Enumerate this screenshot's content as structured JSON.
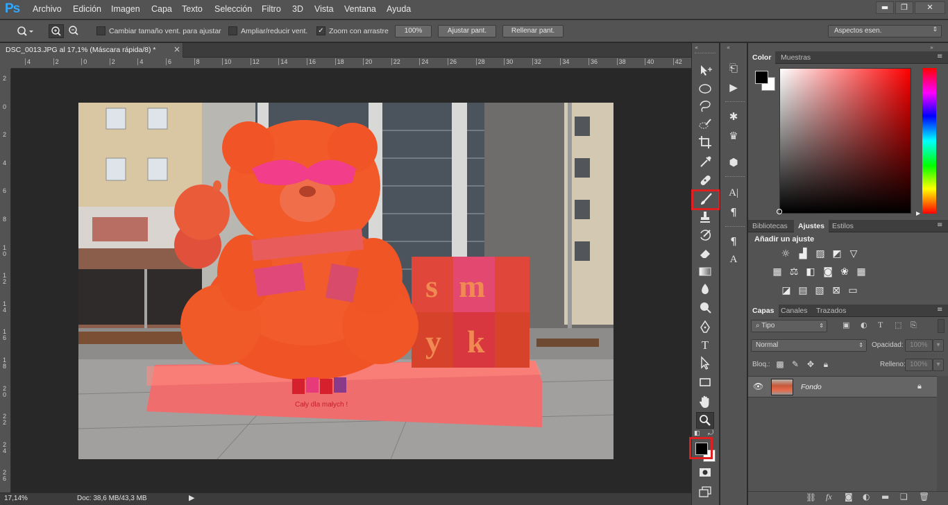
{
  "app": {
    "logo": "Ps"
  },
  "menu": {
    "items": [
      "Archivo",
      "Edición",
      "Imagen",
      "Capa",
      "Texto",
      "Selección",
      "Filtro",
      "3D",
      "Vista",
      "Ventana",
      "Ayuda"
    ]
  },
  "window_controls": {
    "minimize": "▬",
    "restore": "❐",
    "close": "✕"
  },
  "options_bar": {
    "resize_windows_label": "Cambiar tamaño vent. para ajustar",
    "zoom_all_windows_label": "Ampliar/reducir vent.",
    "scrubby_zoom_label": "Zoom con arrastre",
    "scrubby_zoom_checked": true,
    "zoom_100_label": "100%",
    "fit_screen_label": "Ajustar pant.",
    "fill_screen_label": "Rellenar pant.",
    "workspace_label": "Aspectos esen."
  },
  "document": {
    "tab_title": "DSC_0013.JPG al 17,1% (Máscara rápida/8) *",
    "tab_close": "×",
    "ruler_h": [
      "4",
      "2",
      "0",
      "2",
      "4",
      "6",
      "8",
      "10",
      "12",
      "14",
      "16",
      "18",
      "20",
      "22",
      "24",
      "26",
      "28",
      "30",
      "32",
      "34",
      "36",
      "38",
      "40",
      "42"
    ],
    "ruler_v": [
      "2",
      "0",
      "2",
      "4",
      "6",
      "8",
      "10",
      "12",
      "14",
      "16",
      "18",
      "20",
      "22",
      "24",
      "26"
    ],
    "zoom": "17,14%",
    "doc_size": "Doc: 38,6 MB/43,3 MB"
  },
  "photo": {
    "sign_text": "Cały dla małych !",
    "block_letters": [
      "s",
      "m",
      "y",
      "k"
    ]
  },
  "colors": {
    "foreground": "#000000",
    "background": "#ffffff",
    "quick_mask_overlay": "#ff4b3a",
    "highlight": "#e02020"
  },
  "color_panel": {
    "tabs": [
      "Color",
      "Muestras"
    ],
    "active": "Color"
  },
  "adjustments_panel": {
    "tabs": [
      "Bibliotecas",
      "Ajustes",
      "Estilos"
    ],
    "active": "Ajustes",
    "title": "Añadir un ajuste"
  },
  "layers_panel": {
    "tabs": [
      "Capas",
      "Canales",
      "Trazados"
    ],
    "active": "Capas",
    "filter_label": "Tipo",
    "blend_mode": "Normal",
    "opacity_label": "Opacidad:",
    "opacity_value": "100%",
    "lock_label": "Bloq.:",
    "fill_label": "Relleno:",
    "fill_value": "100%",
    "layers": [
      {
        "name": "Fondo",
        "visible": true,
        "locked": true
      }
    ]
  }
}
